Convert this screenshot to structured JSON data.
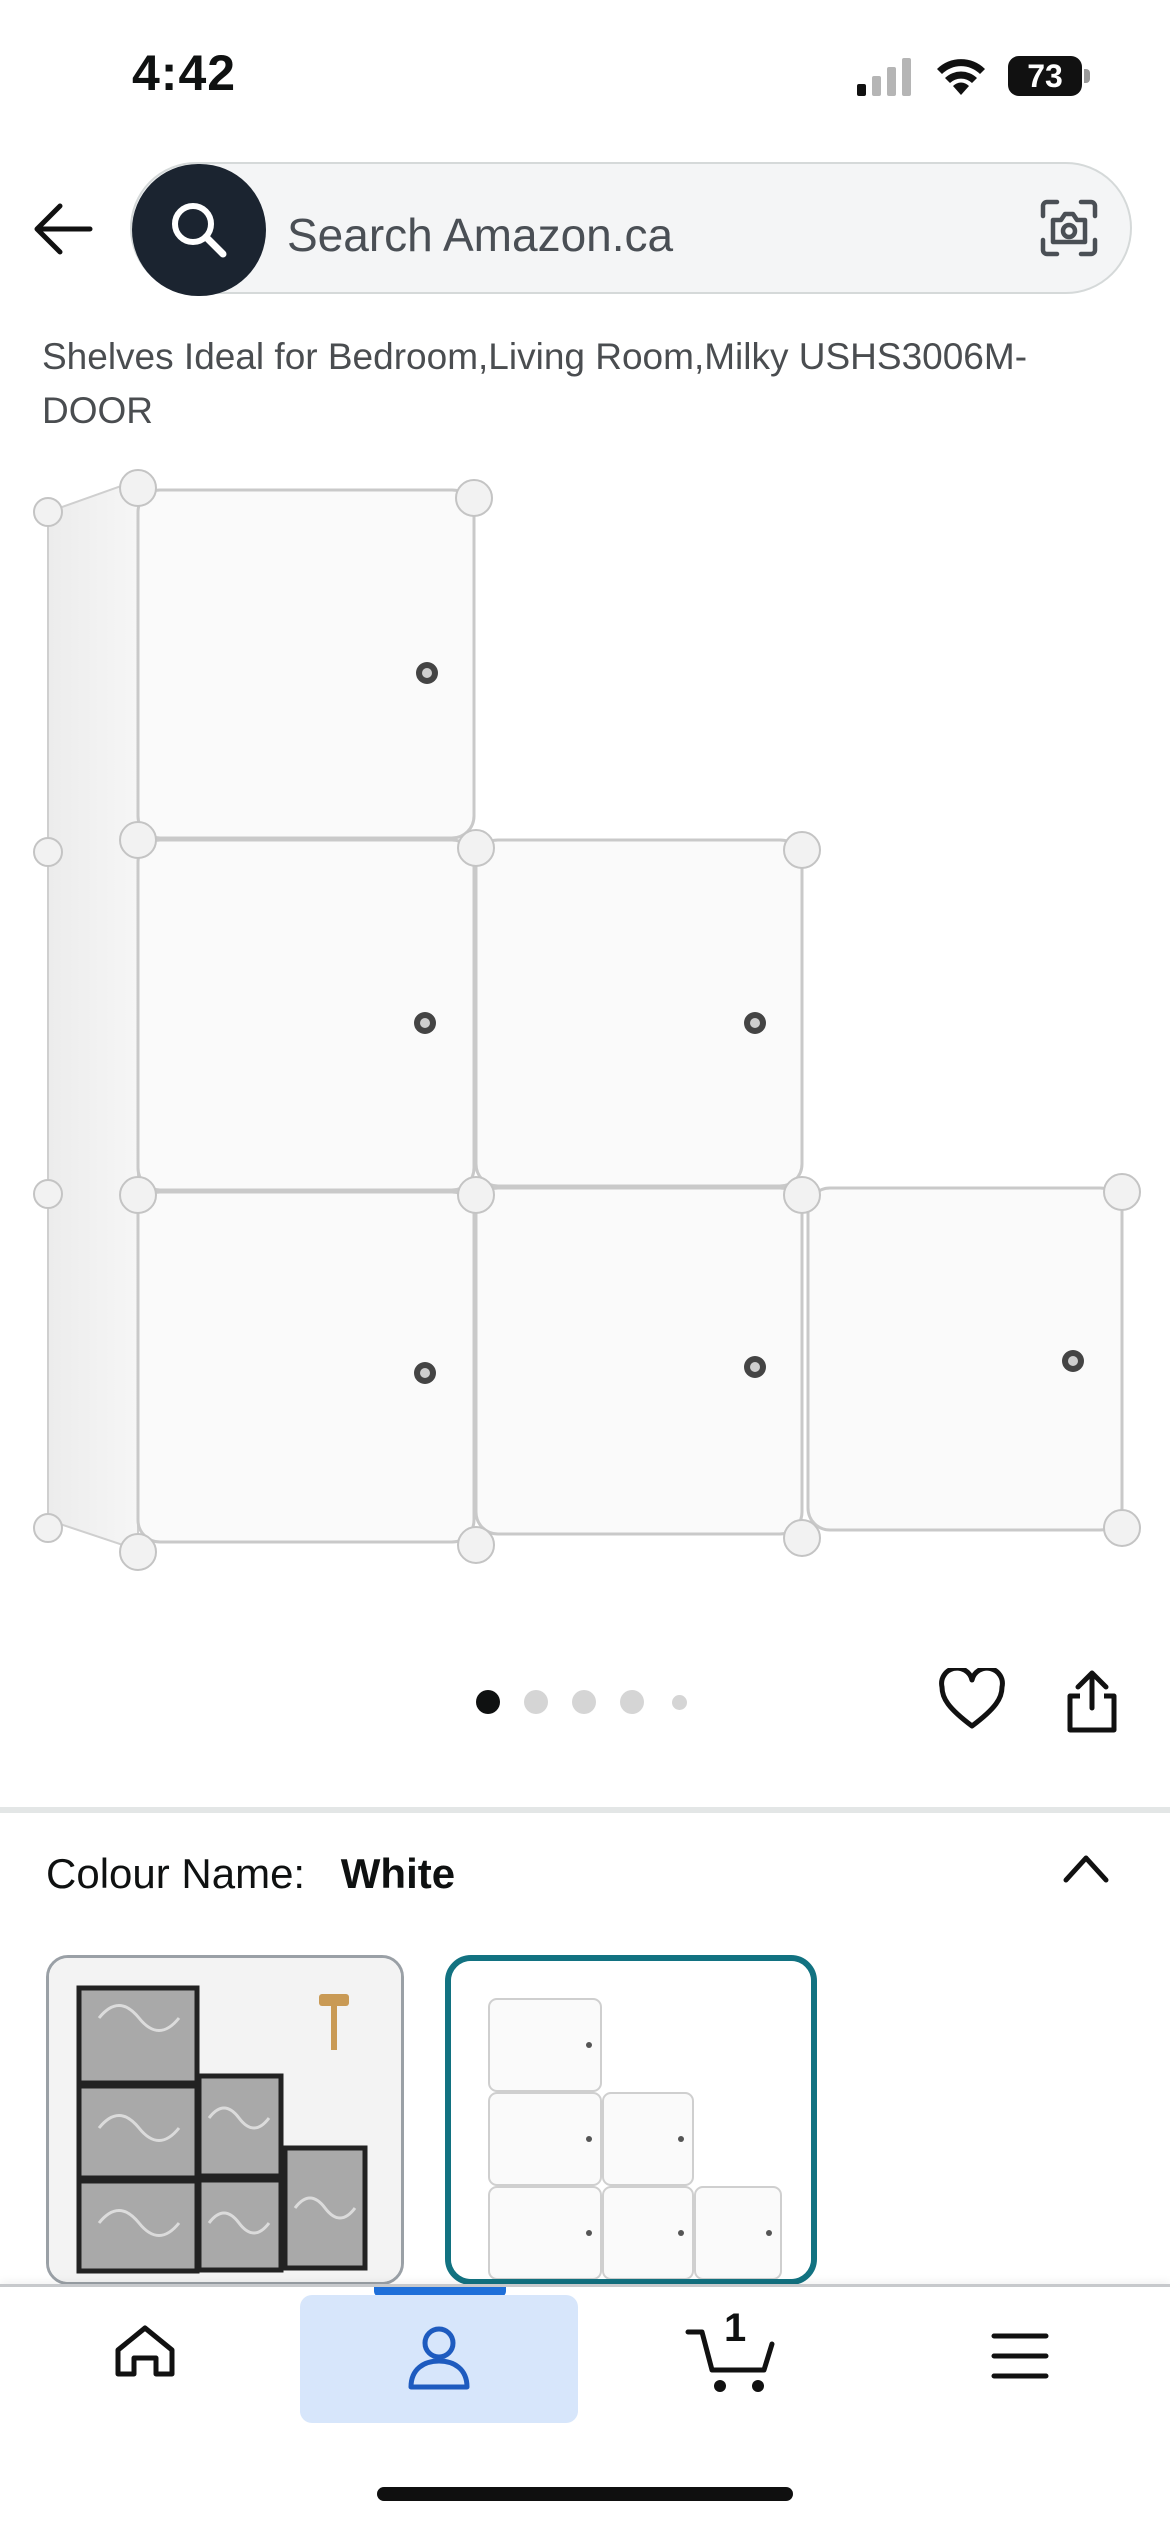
{
  "status_bar": {
    "time": "4:42",
    "battery": "73"
  },
  "header": {
    "search_placeholder": "Search Amazon.ca"
  },
  "product": {
    "title": "Shelves Ideal for Bedroom,Living Room,Milky USHS3006M-DOOR",
    "image_count": 5,
    "active_image_index": 0
  },
  "colour": {
    "label": "Colour Name:",
    "value": "White",
    "options": [
      "Black",
      "White"
    ],
    "selected": "White"
  },
  "bottom_nav": {
    "items": [
      "home",
      "account",
      "cart",
      "menu"
    ],
    "active": "account",
    "cart_count": "1"
  },
  "colors": {
    "search_button": "#1b2430",
    "selected_swatch_border": "#127281",
    "nav_active_bg": "#d7e6fb",
    "nav_active_indicator": "#1e6fd9"
  }
}
